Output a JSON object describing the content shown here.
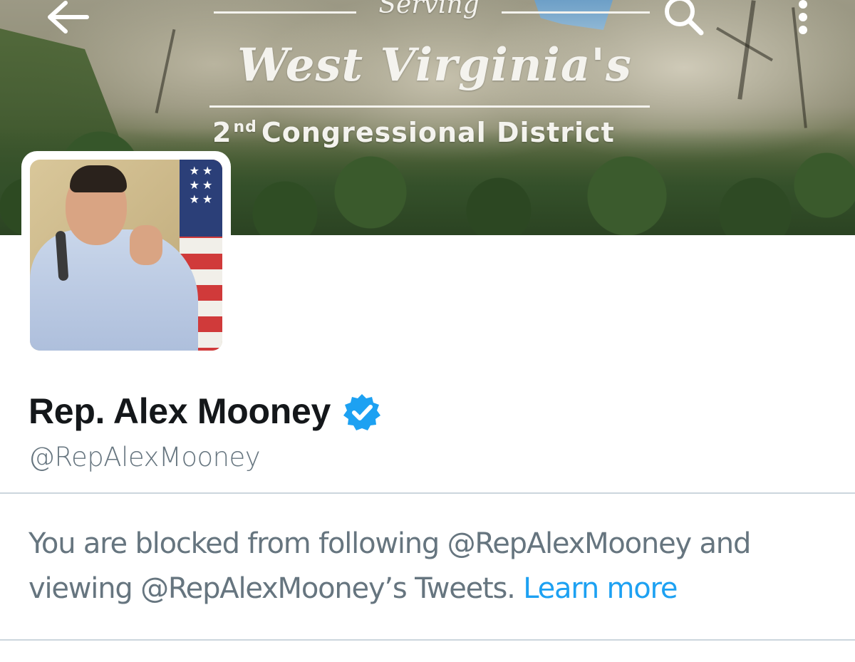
{
  "header": {
    "banner_text": {
      "serving": "Serving",
      "state": "West Virginia's",
      "district_ordinal_number": "2",
      "district_ordinal_suffix": "nd",
      "district": "Congressional District"
    },
    "icons": {
      "back": "arrow-left-icon",
      "search": "search-icon",
      "more": "more-vertical-icon"
    }
  },
  "profile": {
    "name": "Rep. Alex Mooney",
    "handle": "@RepAlexMooney",
    "verified": true,
    "verified_icon": "verified-badge-icon",
    "avatar_alt": "avatar-photo",
    "flag_stars": "★ ★\n★ ★\n★ ★"
  },
  "notice": {
    "text": "You are blocked from following @RepAlexMooney and viewing @RepAlexMooney’s Tweets.",
    "link_label": "Learn more"
  },
  "colors": {
    "link": "#1da1f2",
    "verified": "#1da1f2",
    "text_primary": "#14171a",
    "text_secondary": "#66757f",
    "divider": "#ccd6dd"
  }
}
